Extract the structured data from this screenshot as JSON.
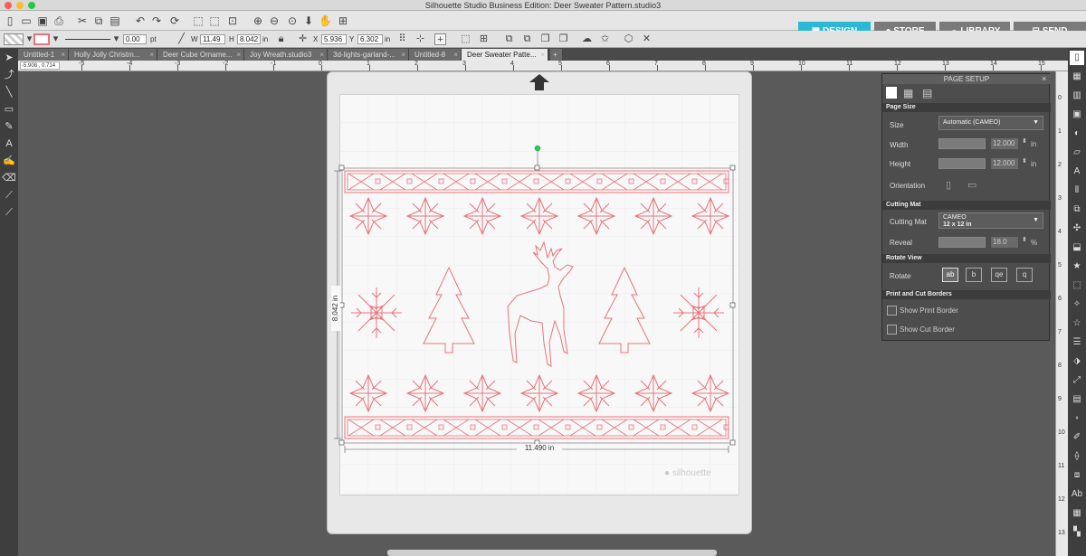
{
  "window": {
    "title": "Silhouette Studio Business Edition: Deer Sweater Pattern.studio3"
  },
  "nav": {
    "design": "DESIGN",
    "store": "STORE",
    "library": "LIBRARY",
    "send": "SEND"
  },
  "toolbar": {
    "line_width": "0.00",
    "line_unit": "pt",
    "w_label": "W",
    "w_value": "11.49",
    "h_label": "H",
    "h_value": "8.042",
    "h_unit": "in",
    "x_label": "X",
    "x_value": "5.936",
    "y_label": "Y",
    "y_value": "6.302",
    "y_unit": "in"
  },
  "tabs": [
    {
      "label": "Untitled-1"
    },
    {
      "label": "Holly Jolly Christm..."
    },
    {
      "label": "Deer Cube Orname..."
    },
    {
      "label": "Joy Wreath.studio3"
    },
    {
      "label": "3d-lights-garland-..."
    },
    {
      "label": "Untitled-8"
    },
    {
      "label": "Deer Sweater Patte..."
    }
  ],
  "add_tab": "+",
  "coords": "-5.908 , 0.714",
  "hruler_nums": [
    "-5",
    "-4",
    "-3",
    "-2",
    "-1",
    "0",
    "1",
    "2",
    "3",
    "4",
    "5",
    "6",
    "7",
    "8",
    "9",
    "10",
    "11",
    "12",
    "13",
    "14",
    "15",
    "16",
    "17",
    "18",
    "19",
    "20",
    "21"
  ],
  "vruler_nums": [
    "0",
    "1",
    "2",
    "3",
    "4",
    "5",
    "6",
    "7",
    "8",
    "9",
    "10",
    "11",
    "12",
    "13",
    "14"
  ],
  "canvas": {
    "width_dim": "11.490 in",
    "height_dim": "8.042 in",
    "watermark": "silhouette"
  },
  "panel": {
    "title": "PAGE SETUP",
    "page_size_section": "Page Size",
    "size_label": "Size",
    "size_value": "Automatic (CAMEO)",
    "width_label": "Width",
    "width_value": "12.000",
    "width_unit": "in",
    "height_label": "Height",
    "height_value": "12.000",
    "height_unit": "in",
    "orientation_label": "Orientation",
    "cutting_mat_section": "Cutting Mat",
    "cutting_mat_label": "Cutting Mat",
    "cutting_mat_line1": "CAMEO",
    "cutting_mat_line2": "12 x 12 in",
    "reveal_label": "Reveal",
    "reveal_value": "18.0",
    "reveal_unit": "%",
    "rotate_view_section": "Rotate View",
    "rotate_label": "Rotate",
    "print_cut_section": "Print and Cut Borders",
    "show_print_border": "Show Print Border",
    "show_cut_border": "Show Cut Border"
  },
  "colors": {
    "accent": "#2bb8d4",
    "cut_line": "#e8737a"
  }
}
